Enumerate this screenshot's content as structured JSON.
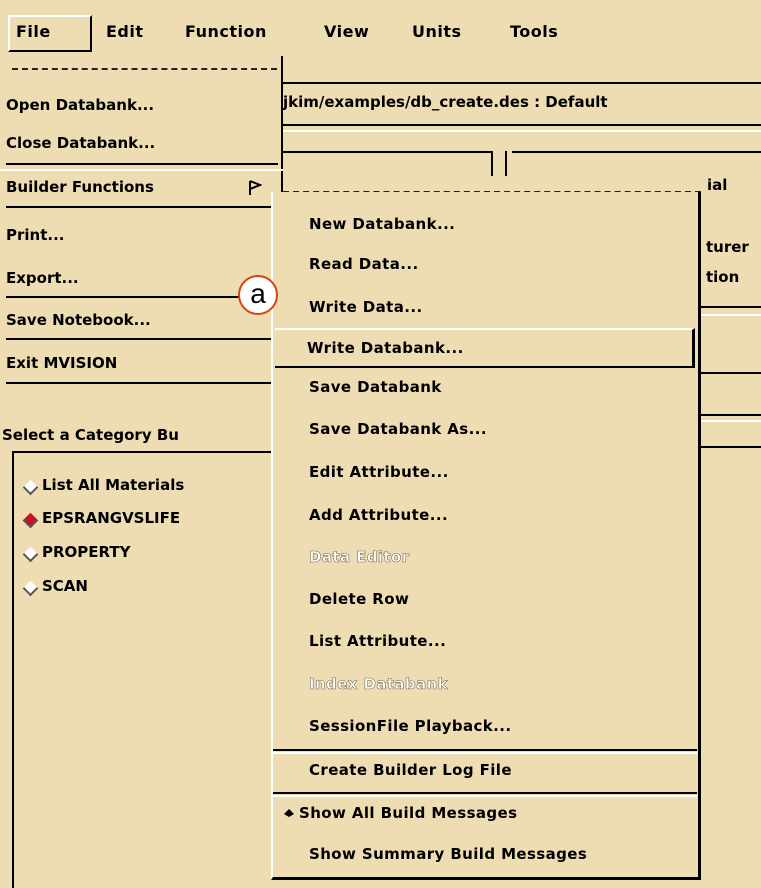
{
  "menubar": {
    "items": [
      "File",
      "Edit",
      "Function",
      "View",
      "Units",
      "Tools"
    ]
  },
  "background": {
    "path_text": "jkim/examples/db_create.des : Default",
    "right_fragment_1": "ial",
    "right_fragment_2": "turer",
    "right_fragment_3": "tion",
    "category_label": "Select a Category Bu",
    "categories": [
      {
        "label": "List All Materials",
        "selected": false
      },
      {
        "label": "EPSRANGVSLIFE",
        "selected": true
      },
      {
        "label": "PROPERTY",
        "selected": false
      },
      {
        "label": "SCAN",
        "selected": false
      }
    ]
  },
  "file_menu": {
    "items": [
      "Open Databank...",
      "Close Databank...",
      "Builder Functions",
      "Print...",
      "Export...",
      "Save Notebook...",
      "Exit MVISION"
    ]
  },
  "builder_menu": {
    "items": [
      {
        "label": "New Databank...",
        "enabled": true
      },
      {
        "label": "Read Data...",
        "enabled": true
      },
      {
        "label": "Write Data...",
        "enabled": true
      },
      {
        "label": "Write Databank...",
        "enabled": true
      },
      {
        "label": "Save Databank",
        "enabled": true
      },
      {
        "label": "Save Databank As...",
        "enabled": true
      },
      {
        "label": "Edit Attribute...",
        "enabled": true
      },
      {
        "label": "Add Attribute...",
        "enabled": true
      },
      {
        "label": "Data Editor",
        "enabled": false
      },
      {
        "label": "Delete Row",
        "enabled": true
      },
      {
        "label": "List Attribute...",
        "enabled": true
      },
      {
        "label": "Index Databank",
        "enabled": false
      },
      {
        "label": "SessionFile Playback...",
        "enabled": true
      },
      {
        "label": "Create Builder Log File",
        "enabled": true
      },
      {
        "label": "Show All Build Messages",
        "enabled": true,
        "selected": true
      },
      {
        "label": "Show Summary Build Messages",
        "enabled": true,
        "selected": false
      }
    ]
  },
  "callout": {
    "label": "a",
    "color": "#d64510"
  },
  "colors": {
    "background": "#eedcb3",
    "selected_radio": "#c8102e"
  }
}
